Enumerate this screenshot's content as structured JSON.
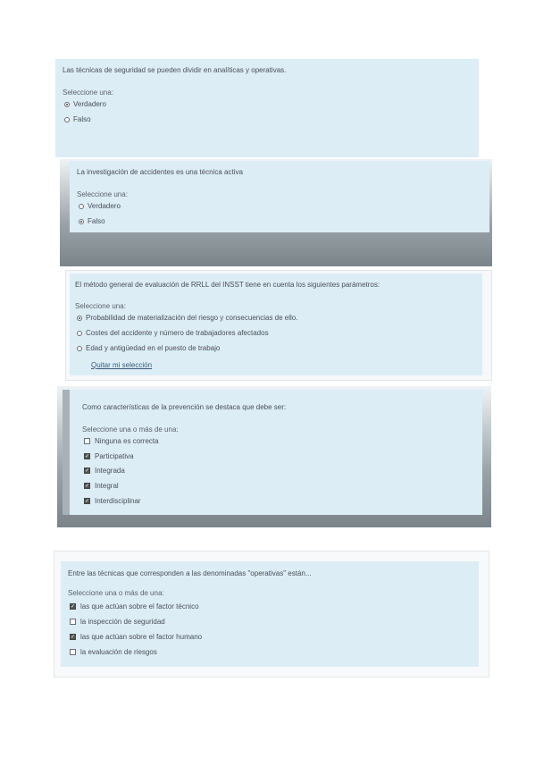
{
  "q1": {
    "question": "Las técnicas de seguridad se pueden dividir en analíticas y operativas.",
    "hint": "Seleccione una:",
    "options": [
      {
        "label": "Verdadero",
        "selected": true
      },
      {
        "label": "Falso",
        "selected": false
      }
    ]
  },
  "q2": {
    "question": "La investigación de accidentes es una técnica activa",
    "hint": "Seleccione una:",
    "options": [
      {
        "label": "Verdadero",
        "selected": false
      },
      {
        "label": "Falso",
        "selected": true
      }
    ]
  },
  "q3": {
    "question": "El método general de evaluación de RRLL del INSST tiene en cuenta los siguientes parámetros:",
    "hint": "Seleccione una:",
    "options": [
      {
        "label": "Probabilidad de materialización del riesgo y consecuencias de ello.",
        "selected": true
      },
      {
        "label": "Costes del accidente y número de trabajadores afectados",
        "selected": false
      },
      {
        "label": "Edad y antigüedad en el puesto de trabajo",
        "selected": false
      }
    ],
    "clear_link": "Quitar mi selección"
  },
  "q4": {
    "question": "Como características de la prevención se destaca que debe ser:",
    "hint": "Seleccione una o más de una:",
    "options": [
      {
        "label": "Ninguna es correcta",
        "checked": false
      },
      {
        "label": "Participativa",
        "checked": true
      },
      {
        "label": "Integrada",
        "checked": true
      },
      {
        "label": "Integral",
        "checked": true
      },
      {
        "label": "Interdisciplinar",
        "checked": true
      }
    ]
  },
  "q5": {
    "question": "Entre las técnicas que corresponden a las denominadas \"operativas\" están...",
    "hint": "Seleccione una o más de una:",
    "options": [
      {
        "label": "las que actúan sobre el factor técnico",
        "checked": true
      },
      {
        "label": "la inspección de seguridad",
        "checked": false
      },
      {
        "label": "las que actúan sobre el factor humano",
        "checked": true
      },
      {
        "label": "la evaluación de riesgos",
        "checked": false
      }
    ]
  }
}
